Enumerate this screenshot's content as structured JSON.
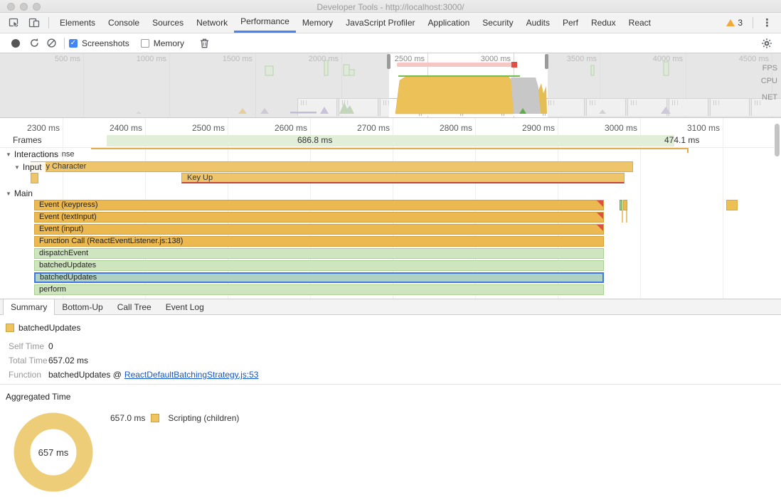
{
  "window": {
    "title": "Developer Tools - http://localhost:3000/"
  },
  "tabbar": {
    "tabs": [
      {
        "label": "Elements"
      },
      {
        "label": "Console"
      },
      {
        "label": "Sources"
      },
      {
        "label": "Network"
      },
      {
        "label": "Performance"
      },
      {
        "label": "Memory"
      },
      {
        "label": "JavaScript Profiler"
      },
      {
        "label": "Application"
      },
      {
        "label": "Security"
      },
      {
        "label": "Audits"
      },
      {
        "label": "Perf"
      },
      {
        "label": "Redux"
      },
      {
        "label": "React"
      }
    ],
    "selected": "Performance",
    "warning_count": "3"
  },
  "toolbar": {
    "screenshots": "Screenshots",
    "memory": "Memory"
  },
  "overview": {
    "ticks": [
      {
        "label": "500 ms"
      },
      {
        "label": "1000 ms"
      },
      {
        "label": "1500 ms"
      },
      {
        "label": "2000 ms"
      },
      {
        "label": "2500 ms"
      },
      {
        "label": "3000 ms"
      },
      {
        "label": "3500 ms"
      },
      {
        "label": "4000 ms"
      },
      {
        "label": "4500 ms"
      }
    ],
    "lanes": {
      "fps": "FPS",
      "cpu": "CPU",
      "net": "NET"
    }
  },
  "timeline": {
    "ticks": [
      {
        "label": "2300 ms"
      },
      {
        "label": "2400 ms"
      },
      {
        "label": "2500 ms"
      },
      {
        "label": "2600 ms"
      },
      {
        "label": "2700 ms"
      },
      {
        "label": "2800 ms"
      },
      {
        "label": "2900 ms"
      },
      {
        "label": "3000 ms"
      },
      {
        "label": "3100 ms"
      }
    ],
    "frames": {
      "label": "Frames",
      "frame1": "686.8 ms",
      "frame2": "474.1 ms"
    },
    "interactions": {
      "header": "Interactions",
      "response": "Response",
      "input_header": "Input",
      "input_bar": "Key Character",
      "keyup": "Key Up"
    },
    "main": {
      "header": "Main",
      "bars": [
        {
          "label": "Event (keypress)"
        },
        {
          "label": "Event (textInput)"
        },
        {
          "label": "Event (input)"
        },
        {
          "label": "Function Call (ReactEventListener.js:138)"
        },
        {
          "label": "dispatchEvent"
        },
        {
          "label": "batchedUpdates"
        },
        {
          "label": "batchedUpdates"
        },
        {
          "label": "perform"
        }
      ]
    }
  },
  "bottom": {
    "tabs": [
      {
        "label": "Summary"
      },
      {
        "label": "Bottom-Up"
      },
      {
        "label": "Call Tree"
      },
      {
        "label": "Event Log"
      }
    ],
    "selected": "Summary",
    "summary": {
      "title": "batchedUpdates",
      "self_time_label": "Self Time",
      "self_time_value": "0",
      "total_time_label": "Total Time",
      "total_time_value": "657.02 ms",
      "function_label": "Function",
      "function_text": "batchedUpdates @",
      "function_link": "ReactDefaultBatchingStrategy.js:53"
    },
    "aggregated": {
      "title": "Aggregated Time",
      "donut_center": "657 ms",
      "legend_value": "657.0 ms",
      "legend_label": "Scripting (children)"
    }
  },
  "chart_data": {
    "type": "pie",
    "title": "Aggregated Time",
    "categories": [
      "Scripting (children)"
    ],
    "values": [
      657.0
    ],
    "units": "ms",
    "center_label": "657 ms",
    "colors": [
      "#eecd78"
    ],
    "legend_position": "right"
  }
}
